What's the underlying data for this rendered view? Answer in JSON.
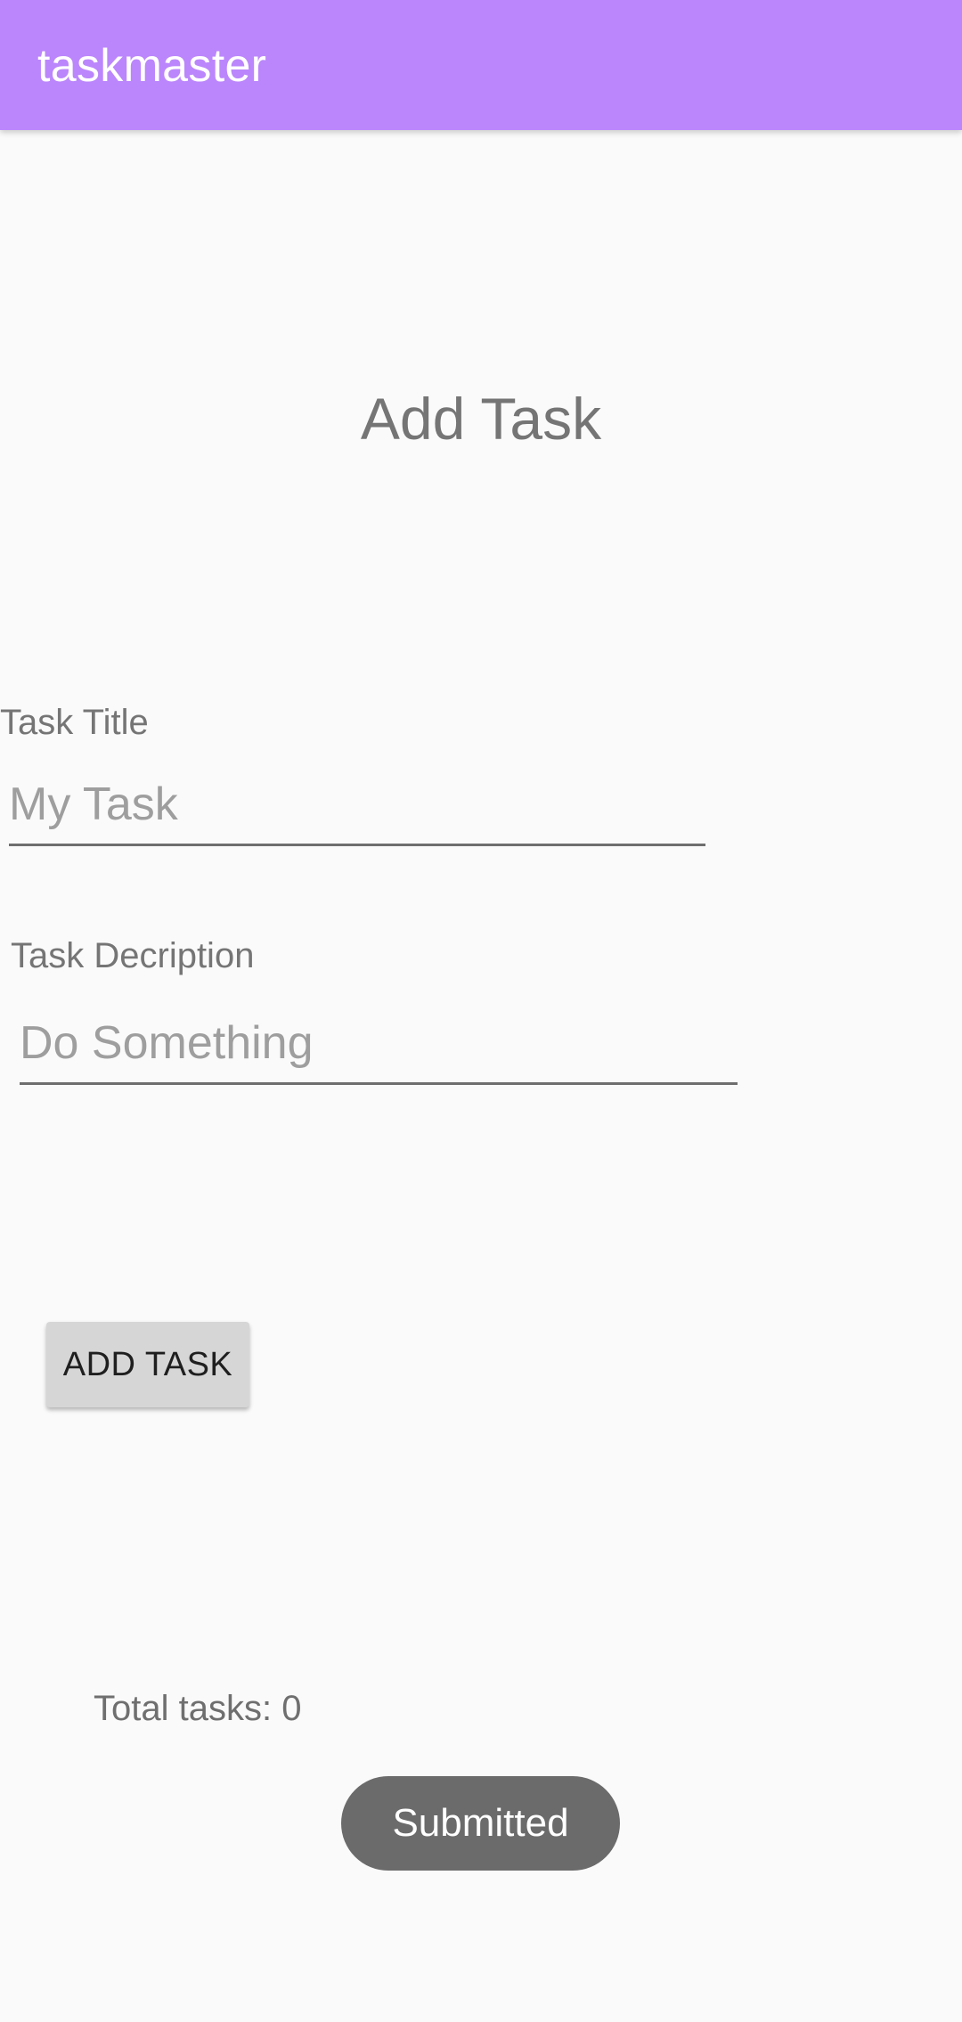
{
  "app_bar": {
    "title": "taskmaster",
    "color": "#bb86fc"
  },
  "page": {
    "title": "Add Task"
  },
  "form": {
    "task_title": {
      "label": "Task Title",
      "value": "",
      "placeholder": "My Task"
    },
    "task_description": {
      "label": "Task Decription",
      "value": "",
      "placeholder": "Do Something"
    },
    "add_button_label": "ADD TASK"
  },
  "status": {
    "total_tasks": "Total tasks: 0"
  },
  "toast": {
    "message": "Submitted"
  }
}
